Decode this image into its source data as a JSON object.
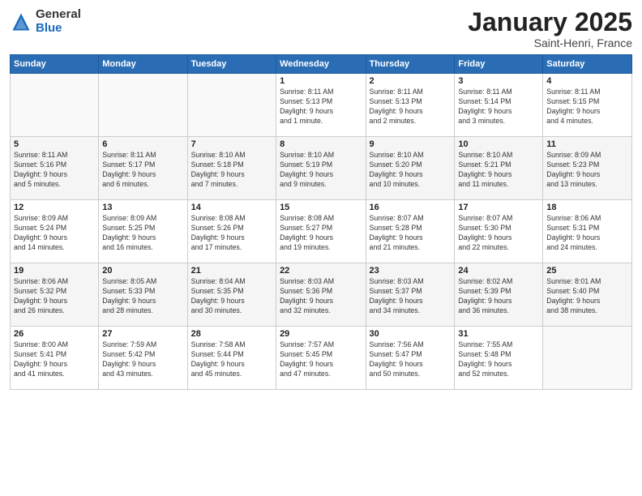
{
  "header": {
    "logo_general": "General",
    "logo_blue": "Blue",
    "month_title": "January 2025",
    "subtitle": "Saint-Henri, France"
  },
  "weekdays": [
    "Sunday",
    "Monday",
    "Tuesday",
    "Wednesday",
    "Thursday",
    "Friday",
    "Saturday"
  ],
  "weeks": [
    [
      {
        "day": "",
        "info": ""
      },
      {
        "day": "",
        "info": ""
      },
      {
        "day": "",
        "info": ""
      },
      {
        "day": "1",
        "info": "Sunrise: 8:11 AM\nSunset: 5:13 PM\nDaylight: 9 hours\nand 1 minute."
      },
      {
        "day": "2",
        "info": "Sunrise: 8:11 AM\nSunset: 5:13 PM\nDaylight: 9 hours\nand 2 minutes."
      },
      {
        "day": "3",
        "info": "Sunrise: 8:11 AM\nSunset: 5:14 PM\nDaylight: 9 hours\nand 3 minutes."
      },
      {
        "day": "4",
        "info": "Sunrise: 8:11 AM\nSunset: 5:15 PM\nDaylight: 9 hours\nand 4 minutes."
      }
    ],
    [
      {
        "day": "5",
        "info": "Sunrise: 8:11 AM\nSunset: 5:16 PM\nDaylight: 9 hours\nand 5 minutes."
      },
      {
        "day": "6",
        "info": "Sunrise: 8:11 AM\nSunset: 5:17 PM\nDaylight: 9 hours\nand 6 minutes."
      },
      {
        "day": "7",
        "info": "Sunrise: 8:10 AM\nSunset: 5:18 PM\nDaylight: 9 hours\nand 7 minutes."
      },
      {
        "day": "8",
        "info": "Sunrise: 8:10 AM\nSunset: 5:19 PM\nDaylight: 9 hours\nand 9 minutes."
      },
      {
        "day": "9",
        "info": "Sunrise: 8:10 AM\nSunset: 5:20 PM\nDaylight: 9 hours\nand 10 minutes."
      },
      {
        "day": "10",
        "info": "Sunrise: 8:10 AM\nSunset: 5:21 PM\nDaylight: 9 hours\nand 11 minutes."
      },
      {
        "day": "11",
        "info": "Sunrise: 8:09 AM\nSunset: 5:23 PM\nDaylight: 9 hours\nand 13 minutes."
      }
    ],
    [
      {
        "day": "12",
        "info": "Sunrise: 8:09 AM\nSunset: 5:24 PM\nDaylight: 9 hours\nand 14 minutes."
      },
      {
        "day": "13",
        "info": "Sunrise: 8:09 AM\nSunset: 5:25 PM\nDaylight: 9 hours\nand 16 minutes."
      },
      {
        "day": "14",
        "info": "Sunrise: 8:08 AM\nSunset: 5:26 PM\nDaylight: 9 hours\nand 17 minutes."
      },
      {
        "day": "15",
        "info": "Sunrise: 8:08 AM\nSunset: 5:27 PM\nDaylight: 9 hours\nand 19 minutes."
      },
      {
        "day": "16",
        "info": "Sunrise: 8:07 AM\nSunset: 5:28 PM\nDaylight: 9 hours\nand 21 minutes."
      },
      {
        "day": "17",
        "info": "Sunrise: 8:07 AM\nSunset: 5:30 PM\nDaylight: 9 hours\nand 22 minutes."
      },
      {
        "day": "18",
        "info": "Sunrise: 8:06 AM\nSunset: 5:31 PM\nDaylight: 9 hours\nand 24 minutes."
      }
    ],
    [
      {
        "day": "19",
        "info": "Sunrise: 8:06 AM\nSunset: 5:32 PM\nDaylight: 9 hours\nand 26 minutes."
      },
      {
        "day": "20",
        "info": "Sunrise: 8:05 AM\nSunset: 5:33 PM\nDaylight: 9 hours\nand 28 minutes."
      },
      {
        "day": "21",
        "info": "Sunrise: 8:04 AM\nSunset: 5:35 PM\nDaylight: 9 hours\nand 30 minutes."
      },
      {
        "day": "22",
        "info": "Sunrise: 8:03 AM\nSunset: 5:36 PM\nDaylight: 9 hours\nand 32 minutes."
      },
      {
        "day": "23",
        "info": "Sunrise: 8:03 AM\nSunset: 5:37 PM\nDaylight: 9 hours\nand 34 minutes."
      },
      {
        "day": "24",
        "info": "Sunrise: 8:02 AM\nSunset: 5:39 PM\nDaylight: 9 hours\nand 36 minutes."
      },
      {
        "day": "25",
        "info": "Sunrise: 8:01 AM\nSunset: 5:40 PM\nDaylight: 9 hours\nand 38 minutes."
      }
    ],
    [
      {
        "day": "26",
        "info": "Sunrise: 8:00 AM\nSunset: 5:41 PM\nDaylight: 9 hours\nand 41 minutes."
      },
      {
        "day": "27",
        "info": "Sunrise: 7:59 AM\nSunset: 5:42 PM\nDaylight: 9 hours\nand 43 minutes."
      },
      {
        "day": "28",
        "info": "Sunrise: 7:58 AM\nSunset: 5:44 PM\nDaylight: 9 hours\nand 45 minutes."
      },
      {
        "day": "29",
        "info": "Sunrise: 7:57 AM\nSunset: 5:45 PM\nDaylight: 9 hours\nand 47 minutes."
      },
      {
        "day": "30",
        "info": "Sunrise: 7:56 AM\nSunset: 5:47 PM\nDaylight: 9 hours\nand 50 minutes."
      },
      {
        "day": "31",
        "info": "Sunrise: 7:55 AM\nSunset: 5:48 PM\nDaylight: 9 hours\nand 52 minutes."
      },
      {
        "day": "",
        "info": ""
      }
    ]
  ]
}
